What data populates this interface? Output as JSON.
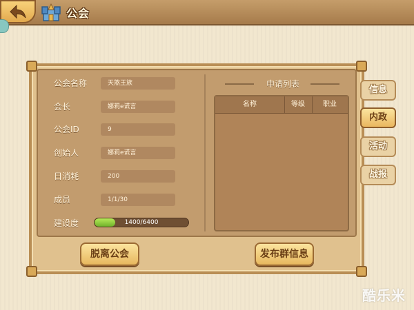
{
  "header": {
    "title": "公会"
  },
  "info": {
    "name_label": "公会名称",
    "name_value": "天煞王族",
    "leader_label": "会长",
    "leader_value": "娜莉e谎言",
    "id_label": "公会ID",
    "id_value": "9",
    "founder_label": "创始人",
    "founder_value": "娜莉e谎言",
    "daily_cost_label": "日消耗",
    "daily_cost_value": "200",
    "members_label": "成员",
    "members_value": "1/1/30",
    "construction_label": "建设度",
    "construction_value": "1400/6400",
    "construction_progress": 0.21875
  },
  "applications": {
    "title": "申请列表",
    "columns": [
      "名称",
      "等级",
      "职业"
    ]
  },
  "buttons": {
    "leave": "脱离公会",
    "broadcast": "发布群信息"
  },
  "tabs": [
    {
      "label": "信息",
      "active": false
    },
    {
      "label": "内政",
      "active": true
    },
    {
      "label": "活动",
      "active": false
    },
    {
      "label": "战报",
      "active": false
    }
  ],
  "watermark": "酷乐米",
  "colors": {
    "accent": "#e8b85f",
    "progress": "#8ccf3a",
    "panel": "#c29c6e"
  }
}
